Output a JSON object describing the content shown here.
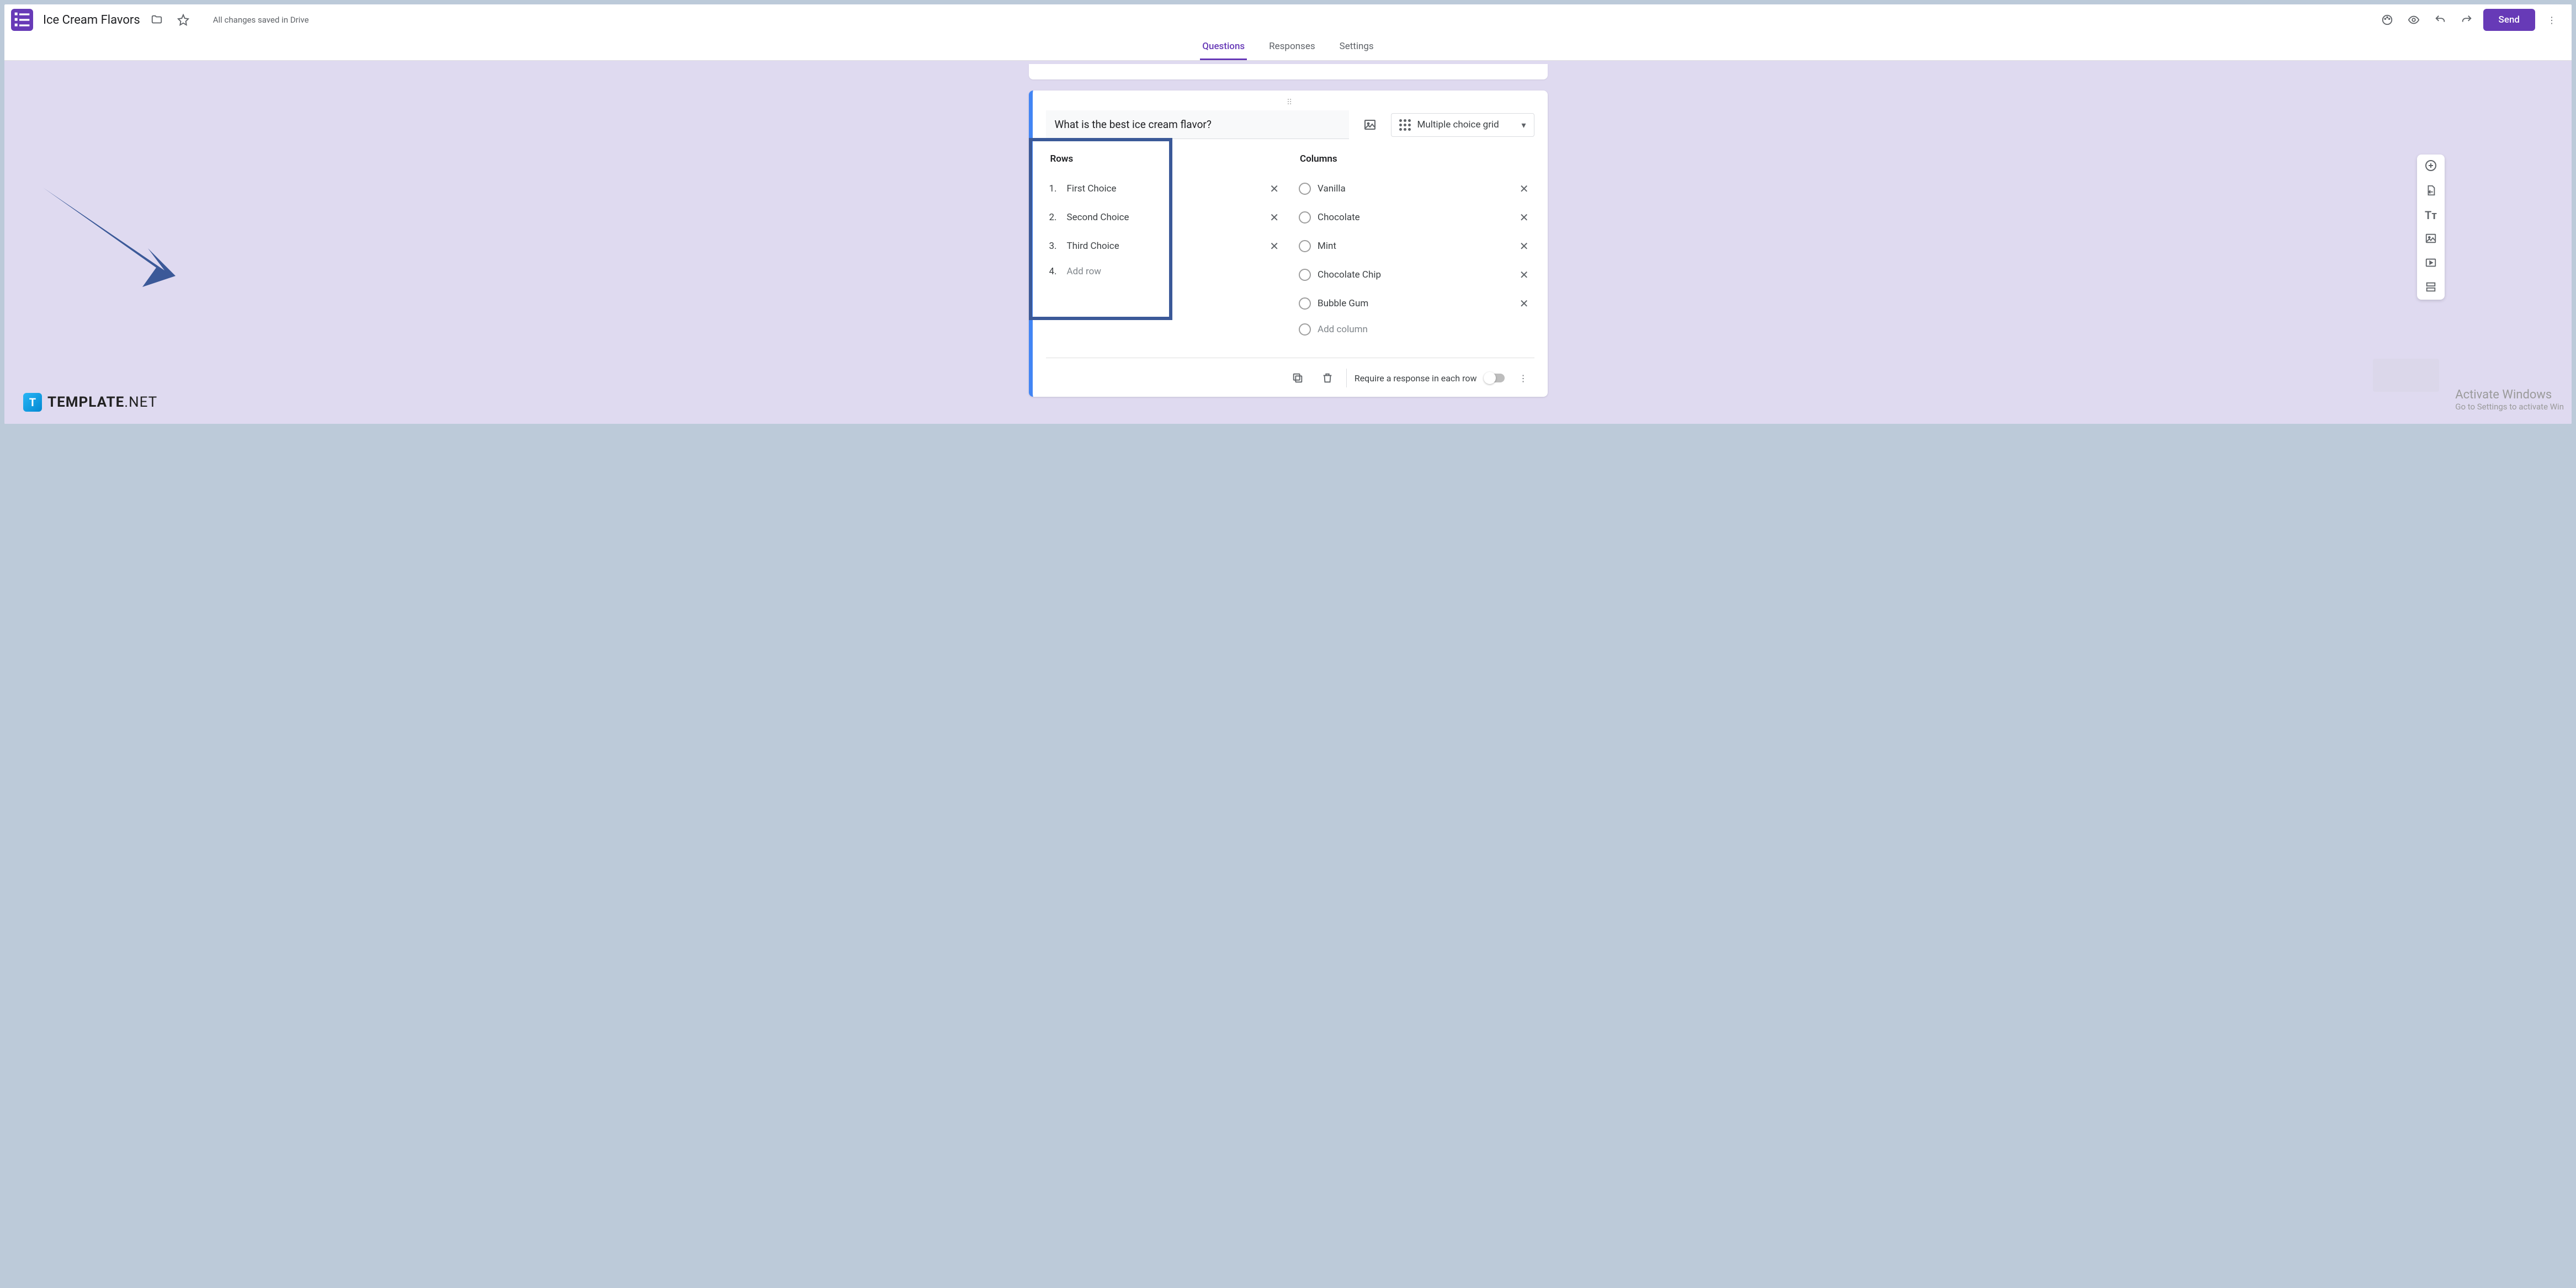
{
  "header": {
    "docTitle": "Ice Cream Flavors",
    "saveStatus": "All changes saved in Drive",
    "sendLabel": "Send"
  },
  "tabs": {
    "questions": "Questions",
    "responses": "Responses",
    "settings": "Settings"
  },
  "question": {
    "text": "What is the best ice cream flavor?",
    "typeLabel": "Multiple choice grid",
    "rowsHeader": "Rows",
    "columnsHeader": "Columns",
    "rows": [
      {
        "num": "1.",
        "label": "First Choice"
      },
      {
        "num": "2.",
        "label": "Second Choice"
      },
      {
        "num": "3.",
        "label": "Third Choice"
      }
    ],
    "addRow": {
      "num": "4.",
      "label": "Add row"
    },
    "columns": [
      {
        "label": "Vanilla"
      },
      {
        "label": "Chocolate"
      },
      {
        "label": "Mint"
      },
      {
        "label": "Chocolate Chip"
      },
      {
        "label": "Bubble Gum"
      }
    ],
    "addColumn": {
      "label": "Add column"
    },
    "requireLabel": "Require a response in each row"
  },
  "watermark": {
    "logoLetter": "T",
    "brandMain": "TEMPLATE",
    "brandSuffix": ".NET"
  },
  "windowsActivate": {
    "line1": "Activate Windows",
    "line2": "Go to Settings to activate Win"
  }
}
